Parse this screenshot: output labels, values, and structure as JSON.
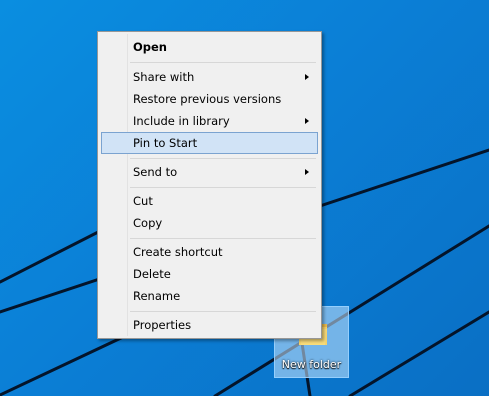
{
  "desktop": {
    "background_color": "#0b7fd6",
    "line_color": "#04142a"
  },
  "context_menu": {
    "items": [
      {
        "label": "Open",
        "bold": true
      },
      {
        "label": "Share with",
        "submenu": true
      },
      {
        "label": "Restore previous versions"
      },
      {
        "label": "Include in library",
        "submenu": true
      },
      {
        "label": "Pin to Start",
        "highlighted": true
      },
      {
        "label": "Send to",
        "submenu": true
      },
      {
        "label": "Cut"
      },
      {
        "label": "Copy"
      },
      {
        "label": "Create shortcut"
      },
      {
        "label": "Delete"
      },
      {
        "label": "Rename"
      },
      {
        "label": "Properties"
      }
    ],
    "highlight_color": "#d1e3f6"
  },
  "desktop_icon": {
    "label": "New folder",
    "icon": "folder-icon",
    "selected": true
  }
}
